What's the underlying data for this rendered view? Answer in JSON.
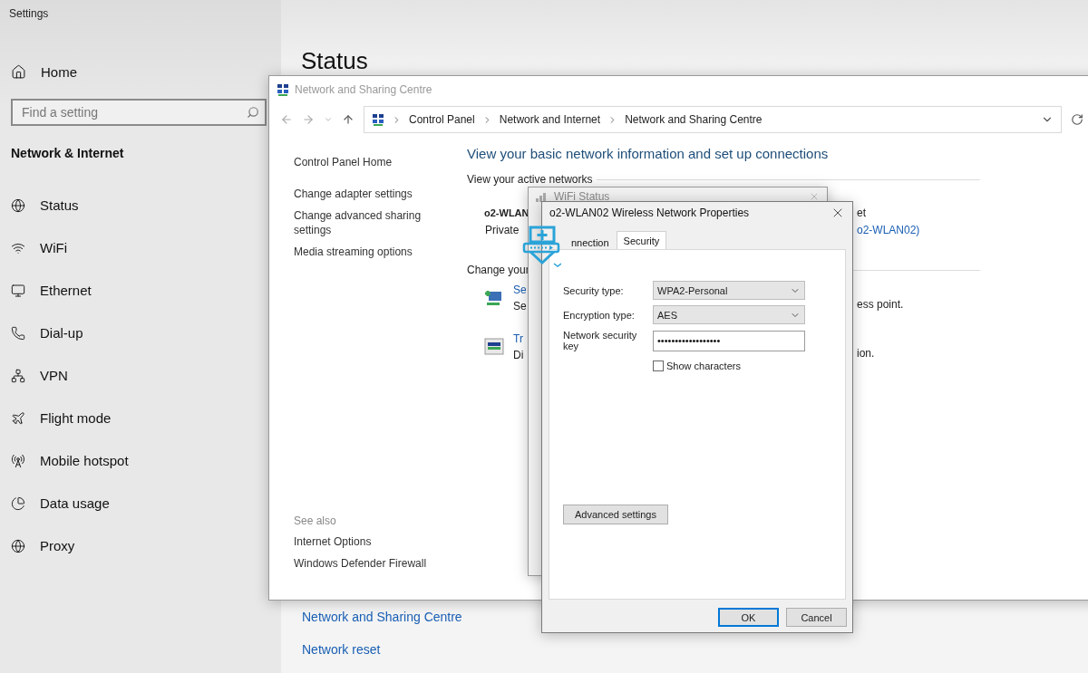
{
  "settings": {
    "title": "Settings",
    "home": "Home",
    "search": {
      "placeholder": "Find a setting"
    },
    "section": "Network & Internet",
    "nav": [
      "Status",
      "WiFi",
      "Ethernet",
      "Dial-up",
      "VPN",
      "Flight mode",
      "Mobile hotspot",
      "Data usage",
      "Proxy"
    ],
    "page_title": "Status",
    "links": [
      "Network and Sharing Centre",
      "Network reset"
    ]
  },
  "control_panel": {
    "title": "Network and Sharing Centre",
    "breadcrumb": [
      "Control Panel",
      "Network and Internet",
      "Network and Sharing Centre"
    ],
    "sidebar": [
      "Control Panel Home",
      "Change adapter settings",
      "Change advanced sharing settings",
      "Media streaming options"
    ],
    "see_also": {
      "heading": "See also",
      "links": [
        "Internet Options",
        "Windows Defender Firewall"
      ]
    },
    "heading": "View your basic network information and set up connections",
    "active_networks": "View your active networks",
    "network_name": "o2-WLAN",
    "network_type": "Private",
    "access_fragment": "et",
    "connection_fragment": "o2-WLAN02)",
    "change_heading": "Change your",
    "tasks": [
      {
        "title": "Se",
        "description": "Se",
        "tail": "ess point."
      },
      {
        "title": "Tr",
        "description": "Di",
        "tail": "ion."
      }
    ]
  },
  "status_window": {
    "title": "WiFi Status"
  },
  "dialog": {
    "title": "o2-WLAN02 Wireless Network Properties",
    "tabs": [
      {
        "label": "nnection",
        "selected": false
      },
      {
        "label": "Security",
        "selected": true
      }
    ],
    "fields": [
      {
        "kind": "select",
        "label": "Security type:",
        "value": "WPA2-Personal"
      },
      {
        "kind": "select",
        "label": "Encryption type:",
        "value": "AES"
      },
      {
        "kind": "password",
        "label": "Network security key",
        "value": "••••••••••••••••••"
      }
    ],
    "show_characters": {
      "label": "Show characters",
      "checked": false
    },
    "advanced": "Advanced settings",
    "buttons": [
      {
        "label": "OK",
        "default": true
      },
      {
        "label": "Cancel",
        "default": false
      }
    ]
  }
}
